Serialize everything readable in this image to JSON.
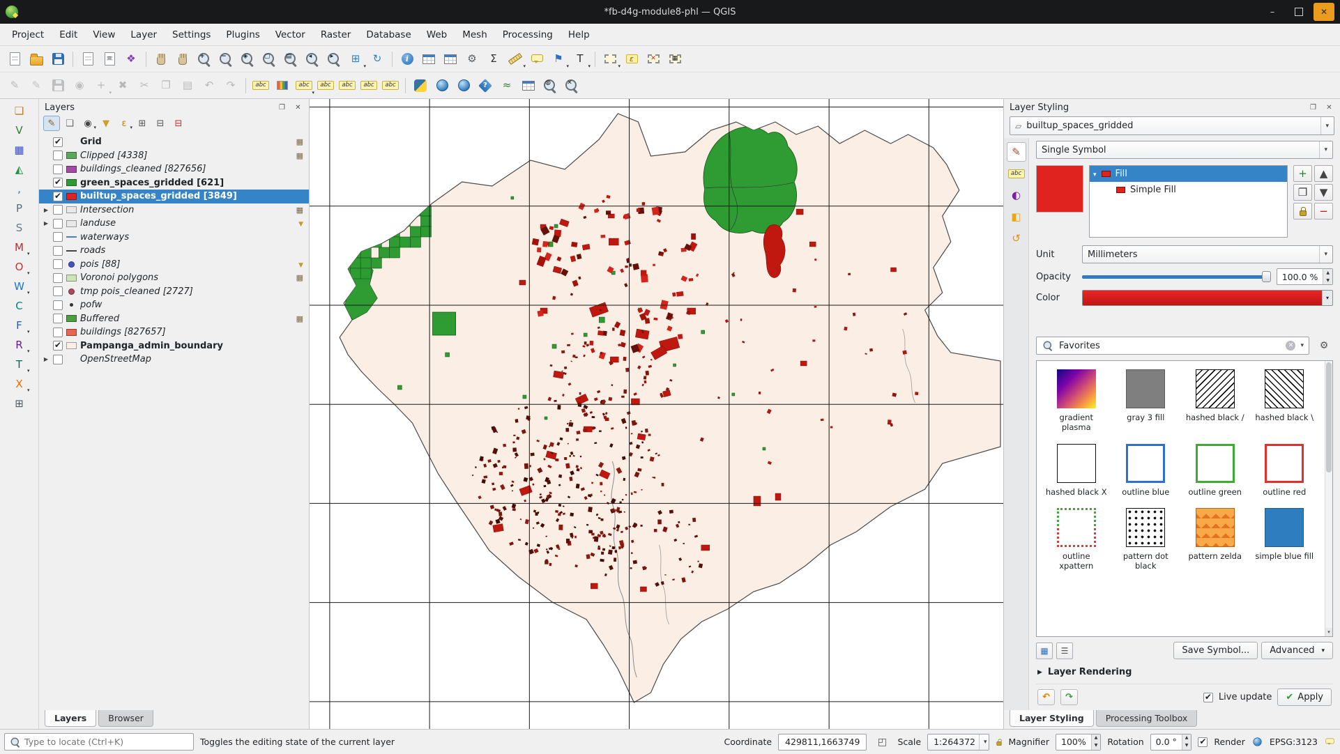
{
  "window": {
    "title": "*fb-d4g-module8-phl — QGIS"
  },
  "colors": {
    "selection_blue": "#3584c8",
    "symbol_red": "#e0231f",
    "green_fill": "#2e9b33",
    "boundary_fill": "#fbeee4"
  },
  "menubar": [
    {
      "label": "Project",
      "name": "menu-project"
    },
    {
      "label": "Edit",
      "name": "menu-edit"
    },
    {
      "label": "View",
      "name": "menu-view"
    },
    {
      "label": "Layer",
      "name": "menu-layer"
    },
    {
      "label": "Settings",
      "name": "menu-settings"
    },
    {
      "label": "Plugins",
      "name": "menu-plugins"
    },
    {
      "label": "Vector",
      "name": "menu-vector"
    },
    {
      "label": "Raster",
      "name": "menu-raster"
    },
    {
      "label": "Database",
      "name": "menu-database"
    },
    {
      "label": "Web",
      "name": "menu-web"
    },
    {
      "label": "Mesh",
      "name": "menu-mesh"
    },
    {
      "label": "Processing",
      "name": "menu-processing"
    },
    {
      "label": "Help",
      "name": "menu-help"
    }
  ],
  "toolbar_main": [
    {
      "name": "new-project-icon",
      "cls": "ic-page",
      "g": "",
      "inter": "true"
    },
    {
      "name": "open-project-icon",
      "cls": "ic-folder",
      "g": "",
      "inter": "true"
    },
    {
      "name": "save-project-icon",
      "cls": "ic-floppy",
      "g": "",
      "inter": "true"
    },
    {
      "name": "separator",
      "bcls": "tsep",
      "inter": "false"
    },
    {
      "name": "new-print-layout-icon",
      "cls": "ic-page",
      "g": "",
      "inter": "true"
    },
    {
      "name": "show-layout-manager-icon",
      "cls": "ic-page",
      "g": "≡",
      "inter": "true"
    },
    {
      "name": "style-manager-icon",
      "g": "❖",
      "c": "#7b3fb3",
      "inter": "true"
    },
    {
      "name": "separator",
      "bcls": "tsep",
      "inter": "false"
    },
    {
      "name": "pan-map-icon",
      "cls": "ic-hand",
      "g": "",
      "inter": "true"
    },
    {
      "name": "pan-to-selection-icon",
      "cls": "ic-hand",
      "g": "",
      "inter": "true"
    },
    {
      "name": "zoom-in-icon",
      "cls": "ic-zoom",
      "g": "+",
      "inter": "true"
    },
    {
      "name": "zoom-out-icon",
      "cls": "ic-zoom",
      "g": "−",
      "inter": "true"
    },
    {
      "name": "zoom-full-extent-icon",
      "cls": "ic-zoom",
      "g": "◈",
      "inter": "true"
    },
    {
      "name": "zoom-to-selection-icon",
      "cls": "ic-zoom",
      "g": "▢",
      "inter": "true"
    },
    {
      "name": "zoom-to-layer-icon",
      "cls": "ic-zoom",
      "g": "▤",
      "inter": "true"
    },
    {
      "name": "zoom-last-icon",
      "cls": "ic-zoom",
      "g": "◂",
      "inter": "true"
    },
    {
      "name": "zoom-next-icon",
      "cls": "ic-zoom",
      "g": "▸",
      "inter": "true"
    },
    {
      "name": "new-map-view-icon",
      "g": "⊞",
      "c": "#2f81c4",
      "dd": "show",
      "inter": "true"
    },
    {
      "name": "refresh-map-icon",
      "g": "↻",
      "c": "#2f81c4",
      "inter": "true"
    },
    {
      "name": "separator",
      "bcls": "tsep",
      "inter": "false"
    },
    {
      "name": "identify-features-icon",
      "cls": "ic-info",
      "g": "i",
      "inter": "true"
    },
    {
      "name": "open-attribute-table-icon",
      "cls": "ic-table",
      "g": "",
      "inter": "true"
    },
    {
      "name": "open-field-calculator-icon",
      "cls": "ic-table",
      "g": "",
      "inter": "true"
    },
    {
      "name": "processing-toolbox-icon",
      "g": "⚙",
      "c": "#5a5f63",
      "inter": "true"
    },
    {
      "name": "statistical-summary-icon",
      "g": "Σ",
      "c": "#333333",
      "inter": "true"
    },
    {
      "name": "measure-icon",
      "cls": "ic-ruler",
      "g": "",
      "dd": "show",
      "inter": "true"
    },
    {
      "name": "map-tips-icon",
      "cls": "ic-bubble",
      "g": "",
      "inter": "true"
    },
    {
      "name": "new-spatial-bookmark-icon",
      "g": "⚑",
      "c": "#2f6fc4",
      "dd": "show",
      "inter": "true"
    },
    {
      "name": "text-annotation-icon",
      "g": "T",
      "c": "#2b2b2b",
      "dd": "show",
      "inter": "true"
    },
    {
      "name": "separator",
      "bcls": "tsep",
      "inter": "false"
    },
    {
      "name": "select-features-icon",
      "cls": "ic-select",
      "g": "",
      "dd": "show",
      "inter": "true"
    },
    {
      "name": "select-by-expression-icon",
      "cls": "ic-eps",
      "g": "ε",
      "inter": "true"
    },
    {
      "name": "deselect-features-icon",
      "cls": "ic-select",
      "g": "✕",
      "c": "#c62828",
      "inter": "true"
    },
    {
      "name": "select-all-features-icon",
      "cls": "ic-select",
      "g": "▦",
      "inter": "true"
    }
  ],
  "toolbar_secondary": [
    {
      "name": "current-edits-icon",
      "g": "✎",
      "c": "#555555",
      "bcls": "dis",
      "inter": "true"
    },
    {
      "name": "toggle-editing-icon",
      "g": "✎",
      "c": "#9a6b1f",
      "bcls": "dis",
      "inter": "true"
    },
    {
      "name": "save-layer-edits-icon",
      "cls": "ic-floppy",
      "g": "",
      "bcls": "dis",
      "inter": "true"
    },
    {
      "name": "add-feature-icon",
      "g": "◉",
      "c": "#2e7d32",
      "bcls": "dis",
      "inter": "true"
    },
    {
      "name": "vertex-tool-icon",
      "g": "+",
      "c": "#555555",
      "bcls": "dis",
      "dd": "show",
      "inter": "true"
    },
    {
      "name": "delete-selected-icon",
      "g": "✖",
      "c": "#b33333",
      "bcls": "dis",
      "inter": "true"
    },
    {
      "name": "cut-features-icon",
      "g": "✂",
      "c": "#555555",
      "bcls": "dis",
      "inter": "true"
    },
    {
      "name": "copy-features-icon",
      "g": "❐",
      "c": "#555555",
      "bcls": "dis",
      "inter": "true"
    },
    {
      "name": "paste-features-icon",
      "g": "▤",
      "c": "#555555",
      "bcls": "dis",
      "inter": "true"
    },
    {
      "name": "undo-icon",
      "g": "↶",
      "c": "#555555",
      "bcls": "dis",
      "inter": "true"
    },
    {
      "name": "redo-icon",
      "g": "↷",
      "c": "#555555",
      "bcls": "dis",
      "inter": "true"
    },
    {
      "name": "separator",
      "bcls": "tsep",
      "inter": "false"
    },
    {
      "name": "layer-labeling-options-icon",
      "cls": "ic-abc",
      "g": "abc",
      "inter": "true"
    },
    {
      "name": "layer-diagram-options-icon",
      "cls": "ic-diagram",
      "g": "",
      "inter": "true"
    },
    {
      "name": "pin-unpin-labels-icon",
      "cls": "ic-abc",
      "g": "abc",
      "dd": "show",
      "inter": "true"
    },
    {
      "name": "highlight-pinned-labels-icon",
      "cls": "ic-abc",
      "g": "abc",
      "inter": "true"
    },
    {
      "name": "move-label-icon",
      "cls": "ic-abc",
      "g": "abc",
      "inter": "true"
    },
    {
      "name": "rotate-label-icon",
      "cls": "ic-abc",
      "g": "abc",
      "inter": "true"
    },
    {
      "name": "change-label-properties-icon",
      "cls": "ic-abc",
      "g": "abc",
      "inter": "true"
    },
    {
      "name": "separator",
      "bcls": "tsep",
      "inter": "false"
    },
    {
      "name": "python-console-icon",
      "cls": "ic-python",
      "g": "",
      "inter": "true"
    },
    {
      "name": "osm-place-search-icon",
      "cls": "ic-globe",
      "g": "",
      "inter": "true"
    },
    {
      "name": "quickmapservices-icon",
      "cls": "ic-globe",
      "g": "",
      "inter": "true"
    },
    {
      "name": "help-contents-icon",
      "cls": "ic-help",
      "g": "?",
      "inter": "true"
    },
    {
      "name": "profile-tool-icon",
      "g": "≈",
      "c": "#2e7d32",
      "inter": "true"
    },
    {
      "name": "data-plugin-icon",
      "cls": "ic-table",
      "g": "",
      "inter": "true"
    },
    {
      "name": "metasearch-icon",
      "cls": "ic-zoom",
      "g": "◍",
      "inter": "true"
    },
    {
      "name": "search-plugin-icon",
      "cls": "ic-zoom",
      "g": "✕",
      "inter": "true"
    }
  ],
  "side_toolbar": [
    {
      "name": "data-source-manager-icon",
      "g": "❏",
      "c": "#b57b2e",
      "inter": "true"
    },
    {
      "name": "add-vector-layer-icon",
      "g": "V",
      "c": "#2e7d32",
      "inter": "true"
    },
    {
      "name": "add-raster-layer-icon",
      "g": "▦",
      "c": "#3f51b5",
      "inter": "true"
    },
    {
      "name": "add-mesh-layer-icon",
      "g": "◭",
      "c": "#1a9641",
      "inter": "true"
    },
    {
      "name": "add-delimited-text-layer-icon",
      "g": ",",
      "c": "#1f6fc4",
      "inter": "true"
    },
    {
      "name": "add-postgis-layer-icon",
      "g": "P",
      "c": "#546e7a",
      "inter": "true"
    },
    {
      "name": "add-spatialite-layer-icon",
      "g": "S",
      "c": "#607d8b",
      "inter": "true"
    },
    {
      "name": "add-mssql-layer-icon",
      "g": "M",
      "c": "#c62828",
      "dd": "show",
      "inter": "true"
    },
    {
      "name": "add-oracle-layer-icon",
      "g": "O",
      "c": "#d32f2f",
      "dd": "show",
      "inter": "true"
    },
    {
      "name": "add-wms-layer-icon",
      "g": "W",
      "c": "#1976d2",
      "dd": "show",
      "inter": "true"
    },
    {
      "name": "add-wcs-layer-icon",
      "g": "C",
      "c": "#00838f",
      "inter": "true"
    },
    {
      "name": "add-wfs-layer-icon",
      "g": "F",
      "c": "#1565c0",
      "dd": "show",
      "inter": "true"
    },
    {
      "name": "add-arcgis-rest-layer-icon",
      "g": "R",
      "c": "#6a1b9a",
      "dd": "show",
      "inter": "true"
    },
    {
      "name": "add-vector-tile-layer-icon",
      "g": "T",
      "c": "#00695c",
      "dd": "show",
      "inter": "true"
    },
    {
      "name": "add-xyz-layer-icon",
      "g": "X",
      "c": "#ef6c00",
      "dd": "show",
      "inter": "true"
    },
    {
      "name": "add-virtual-layer-icon",
      "g": "⊞",
      "c": "#455a64",
      "inter": "true"
    }
  ],
  "layers_panel": {
    "title": "Layers",
    "tools": [
      {
        "name": "open-layer-styling-dock-icon",
        "g": "✎",
        "c": "#8a5a2a",
        "bcls": "pressed",
        "inter": "true"
      },
      {
        "name": "add-group-icon",
        "g": "❏",
        "c": "#666666",
        "inter": "true"
      },
      {
        "name": "manage-map-themes-icon",
        "g": "◉",
        "c": "#444444",
        "dd": "show",
        "inter": "true"
      },
      {
        "name": "filter-legend-icon",
        "g": "▼",
        "c": "#c9a227",
        "inter": "true"
      },
      {
        "name": "filter-legend-by-expression-icon",
        "g": "ε",
        "c": "#b58900",
        "dd": "show",
        "inter": "true"
      },
      {
        "name": "expand-all-icon",
        "g": "⊞",
        "c": "#555555",
        "inter": "true"
      },
      {
        "name": "collapse-all-icon",
        "g": "⊟",
        "c": "#555555",
        "inter": "true"
      },
      {
        "name": "remove-layer-icon",
        "g": "⊟",
        "c": "#c62828",
        "inter": "true"
      }
    ],
    "items": [
      {
        "name": "layer-row-grid",
        "label": "Grid",
        "inter": "true",
        "cb": "on",
        "sw_cls": "none",
        "txt": "b",
        "ind": "mem"
      },
      {
        "name": "layer-row-clipped",
        "label": "Clipped [4338]",
        "inter": "true",
        "sw_cls": "rect",
        "sw": "#5aa85a",
        "txt": "i",
        "ind": "mem"
      },
      {
        "name": "layer-row-buildings-cleaned",
        "label": "buildings_cleaned [827656]",
        "inter": "true",
        "sw_cls": "rect",
        "sw": "#a349a4",
        "txt": "i"
      },
      {
        "name": "layer-row-green-spaces-gridded",
        "label": "green_spaces_gridded [621]",
        "inter": "true",
        "cb": "on",
        "sw_cls": "rect",
        "sw": "#2e9b33",
        "txt": "b"
      },
      {
        "name": "layer-row-builtup-spaces-gridded",
        "label": "builtup_spaces_gridded [3849]",
        "inter": "true",
        "row": "sel",
        "cb": "on",
        "sw_cls": "rect",
        "sw": "#e0231f",
        "txt": "b"
      },
      {
        "name": "layer-row-intersection",
        "label": "Intersection",
        "inter": "true",
        "exp": "show",
        "sw_cls": "rect",
        "sw": "#e9e9e9",
        "txt": "i",
        "ind": "mem"
      },
      {
        "name": "layer-row-landuse",
        "label": "landuse",
        "inter": "true",
        "exp": "show",
        "sw_cls": "rect",
        "sw": "#e9e9e9",
        "txt": "i",
        "ind": "fil"
      },
      {
        "name": "layer-row-waterways",
        "label": "waterways",
        "inter": "true",
        "sw_cls": "line",
        "sw": "#4a7fc1",
        "txt": "i"
      },
      {
        "name": "layer-row-roads",
        "label": "roads",
        "inter": "true",
        "sw_cls": "line",
        "sw": "#444444",
        "txt": "i"
      },
      {
        "name": "layer-row-pois",
        "label": "pois [88]",
        "inter": "true",
        "sw_cls": "dot",
        "sw": "#4452c6",
        "txt": "i",
        "ind": "fil"
      },
      {
        "name": "layer-row-voronoi-polygons",
        "label": "Voronoi polygons",
        "inter": "true",
        "sw_cls": "rect",
        "sw": "#cde6b8",
        "txt": "i",
        "ind": "mem"
      },
      {
        "name": "layer-row-tmp-pois-cleaned",
        "label": "tmp pois_cleaned [2727]",
        "inter": "true",
        "sw_cls": "dot",
        "sw": "#b0485a",
        "txt": "i"
      },
      {
        "name": "layer-row-pofw",
        "label": "pofw",
        "inter": "true",
        "sw_cls": "tinydot",
        "sw": "#333333",
        "txt": "i"
      },
      {
        "name": "layer-row-buffered",
        "label": "Buffered",
        "inter": "true",
        "sw_cls": "rect",
        "sw": "#4d9e43",
        "txt": "i",
        "ind": "mem"
      },
      {
        "name": "layer-row-buildings",
        "label": "buildings [827657]",
        "inter": "true",
        "sw_cls": "rect",
        "sw": "#e8654f",
        "txt": "i"
      },
      {
        "name": "layer-row-pampanga-admin-boundary",
        "label": "Pampanga_admin_boundary",
        "inter": "true",
        "cb": "on",
        "sw_cls": "rect",
        "sw": "#f9efe8",
        "txt": "b"
      },
      {
        "name": "layer-row-openstreetmap",
        "label": "OpenStreetMap",
        "inter": "true",
        "exp": "show",
        "sw_cls": "none",
        "txt": "i"
      }
    ],
    "tabs": [
      {
        "label": "Layers",
        "name": "tab-layers",
        "cls": "active",
        "inter": "true"
      },
      {
        "label": "Browser",
        "name": "tab-browser",
        "inter": "true"
      }
    ]
  },
  "styling_panel": {
    "title": "Layer Styling",
    "layer_combo": "builtup_spaces_gridded",
    "symbol_type": "Single Symbol",
    "strip": [
      {
        "name": "symbology-tab-icon",
        "g": "✎",
        "c": "#a0522d",
        "bcls": "active",
        "inter": "true"
      },
      {
        "name": "labels-tab-icon",
        "cls": "ic-abc",
        "g": "abc",
        "inter": "true"
      },
      {
        "name": "masks-tab-icon",
        "g": "◐",
        "c": "#7b1fa2",
        "inter": "true"
      },
      {
        "name": "view-3d-tab-icon",
        "g": "◧",
        "c": "#e6a817",
        "inter": "true"
      },
      {
        "name": "history-tab-icon",
        "g": "↺",
        "c": "#d99718",
        "inter": "true"
      }
    ],
    "symbol_tree": {
      "root": "Fill",
      "child": "Simple Fill"
    },
    "sym_buttons": [
      {
        "name": "add-symbol-layer-button",
        "g": "+",
        "c": "#2e7d32",
        "inter": "true"
      },
      {
        "name": "move-symbol-layer-up-button",
        "g": "▲",
        "c": "#444444",
        "inter": "true"
      },
      {
        "name": "duplicate-symbol-layer-button",
        "g": "❐",
        "c": "#444444",
        "inter": "true"
      },
      {
        "name": "move-symbol-layer-down-button",
        "g": "▼",
        "c": "#444444",
        "inter": "true"
      },
      {
        "name": "lock-symbol-color-button",
        "cls": "ic-lock",
        "g": "",
        "inter": "true"
      },
      {
        "name": "remove-symbol-layer-button",
        "g": "−",
        "c": "#b71c1c",
        "inter": "true"
      }
    ],
    "unit_label": "Unit",
    "unit_value": "Millimeters",
    "opacity_label": "Opacity",
    "opacity_value": "100.0 %",
    "color_label": "Color",
    "search_placeholder": "Favorites",
    "symbols": [
      {
        "name": "symbol-gradient-plasma",
        "label": "gradient plasma",
        "cls": "sw-plasma",
        "inter": "true"
      },
      {
        "name": "symbol-gray-3-fill",
        "label": "gray 3 fill",
        "cls": "sw-gray",
        "inter": "true"
      },
      {
        "name": "symbol-hashed-black-fwd",
        "label": "hashed black /",
        "cls": "sw-hashf",
        "inter": "true"
      },
      {
        "name": "symbol-hashed-black-back",
        "label": "hashed black \\",
        "cls": "sw-hashb",
        "inter": "true"
      },
      {
        "name": "symbol-hashed-black-x",
        "label": "hashed black X",
        "cls": "sw-hashx",
        "inter": "true"
      },
      {
        "name": "symbol-outline-blue",
        "label": "outline blue",
        "cls": "sw-outblue",
        "inter": "true"
      },
      {
        "name": "symbol-outline-green",
        "label": "outline green",
        "cls": "sw-outgreen",
        "inter": "true"
      },
      {
        "name": "symbol-outline-red",
        "label": "outline red",
        "cls": "sw-outred",
        "inter": "true"
      },
      {
        "name": "symbol-outline-xpattern",
        "label": "outline xpattern",
        "cls": "sw-xpat",
        "inter": "true"
      },
      {
        "name": "symbol-pattern-dot-black",
        "label": "pattern dot black",
        "cls": "sw-dots",
        "inter": "true"
      },
      {
        "name": "symbol-pattern-zelda",
        "label": "pattern zelda",
        "cls": "sw-zelda",
        "inter": "true"
      },
      {
        "name": "symbol-simple-blue-fill",
        "label": "simple blue fill",
        "cls": "sw-blue",
        "inter": "true"
      }
    ],
    "save_symbol_label": "Save Symbol...",
    "advanced_label": "Advanced",
    "layer_rendering_label": "Layer Rendering",
    "live_update_label": "Live update",
    "apply_label": "Apply",
    "tabs": [
      {
        "label": "Layer Styling",
        "name": "tab-layer-styling",
        "cls": "active",
        "inter": "true"
      },
      {
        "label": "Processing Toolbox",
        "name": "tab-processing-toolbox",
        "inter": "true"
      }
    ]
  },
  "statusbar": {
    "locate_placeholder": "Type to locate (Ctrl+K)",
    "message": "Toggles the editing state of the current layer",
    "coordinate_label": "Coordinate",
    "coordinate_value": "429811,1663749",
    "scale_label": "Scale",
    "scale_value": "1:264372",
    "magnifier_label": "Magnifier",
    "magnifier_value": "100%",
    "rotation_label": "Rotation",
    "rotation_value": "0.0 °",
    "render_label": "Render",
    "crs": "EPSG:3123"
  }
}
